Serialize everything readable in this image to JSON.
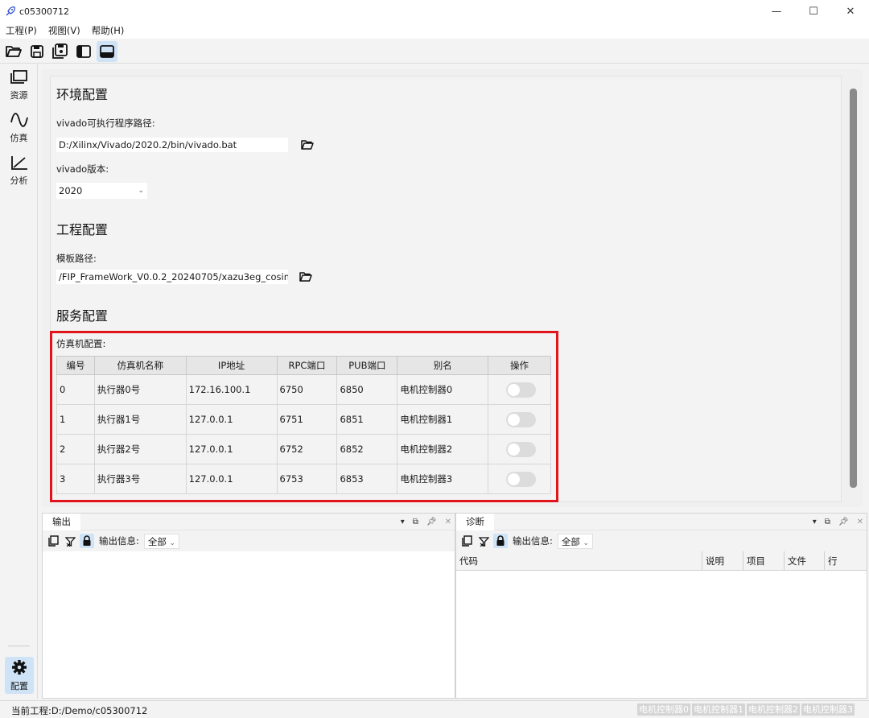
{
  "window": {
    "title": "c05300712",
    "minimize": "—",
    "maximize": "☐",
    "close": "✕"
  },
  "menu": [
    "工程(P)",
    "视图(V)",
    "帮助(H)"
  ],
  "toolbar": {
    "icons": [
      "open-folder-icon",
      "save-icon",
      "save-all-icon",
      "panel-left-icon",
      "panel-bottom-icon"
    ]
  },
  "activity": {
    "items": [
      {
        "label": "资源",
        "icon": "resources-icon"
      },
      {
        "label": "仿真",
        "icon": "simulation-wave-icon"
      },
      {
        "label": "分析",
        "icon": "analysis-chart-icon"
      }
    ],
    "config_label": "配置"
  },
  "env": {
    "section_title": "环境配置",
    "vivado_path_label": "vivado可执行程序路径:",
    "vivado_path_value": "D:/Xilinx/Vivado/2020.2/bin/vivado.bat",
    "vivado_version_label": "vivado版本:",
    "vivado_version_value": "2020"
  },
  "project": {
    "section_title": "工程配置",
    "template_path_label": "模板路径:",
    "template_path_value": "/FIP_FrameWork_V0.0.2_20240705/xazu3eg_cosim_rtl"
  },
  "service": {
    "section_title": "服务配置",
    "table_label": "仿真机配置:",
    "columns": [
      "编号",
      "仿真机名称",
      "IP地址",
      "RPC端口",
      "PUB端口",
      "别名",
      "操作"
    ],
    "rows": [
      {
        "id": "0",
        "name": "执行器0号",
        "ip": "172.16.100.1",
        "rpc": "6750",
        "pub": "6850",
        "alias": "电机控制器0",
        "enabled": false
      },
      {
        "id": "1",
        "name": "执行器1号",
        "ip": "127.0.0.1",
        "rpc": "6751",
        "pub": "6851",
        "alias": "电机控制器1",
        "enabled": false
      },
      {
        "id": "2",
        "name": "执行器2号",
        "ip": "127.0.0.1",
        "rpc": "6752",
        "pub": "6852",
        "alias": "电机控制器2",
        "enabled": false
      },
      {
        "id": "3",
        "name": "执行器3号",
        "ip": "127.0.0.1",
        "rpc": "6753",
        "pub": "6853",
        "alias": "电机控制器3",
        "enabled": false
      }
    ]
  },
  "output_panel": {
    "tab": "输出",
    "filter_label": "输出信息:",
    "filter_value": "全部"
  },
  "diag_panel": {
    "tab": "诊断",
    "filter_label": "输出信息:",
    "filter_value": "全部",
    "columns": [
      "代码",
      "说明",
      "项目",
      "文件",
      "行"
    ]
  },
  "statusbar": {
    "project": "当前工程:D:/Demo/c05300712",
    "badges": [
      "电机控制器0",
      "电机控制器1",
      "电机控制器2",
      "电机控制器3"
    ]
  }
}
